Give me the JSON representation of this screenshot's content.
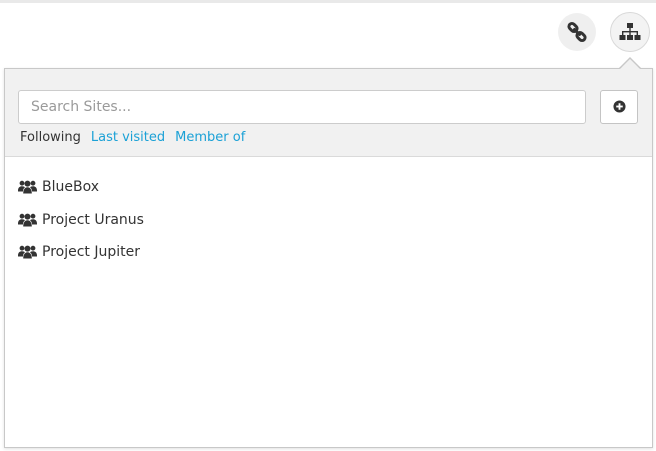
{
  "topbar": {
    "buttons": [
      {
        "name": "link",
        "icon": "link-icon"
      },
      {
        "name": "sites",
        "icon": "sitemap-icon"
      }
    ]
  },
  "dropdown": {
    "search": {
      "placeholder": "Search Sites..."
    },
    "add_button_icon": "plus-circle-icon",
    "tabs": [
      {
        "label": "Following",
        "active": true
      },
      {
        "label": "Last visited",
        "active": false
      },
      {
        "label": "Member of",
        "active": false
      }
    ],
    "sites": [
      {
        "label": "BlueBox",
        "icon": "group-icon"
      },
      {
        "label": "Project Uranus",
        "icon": "group-icon"
      },
      {
        "label": "Project Jupiter",
        "icon": "group-icon"
      }
    ]
  },
  "colors": {
    "link": "#1ba1d6",
    "text": "#333333",
    "header_bg": "#f1f1f1"
  }
}
